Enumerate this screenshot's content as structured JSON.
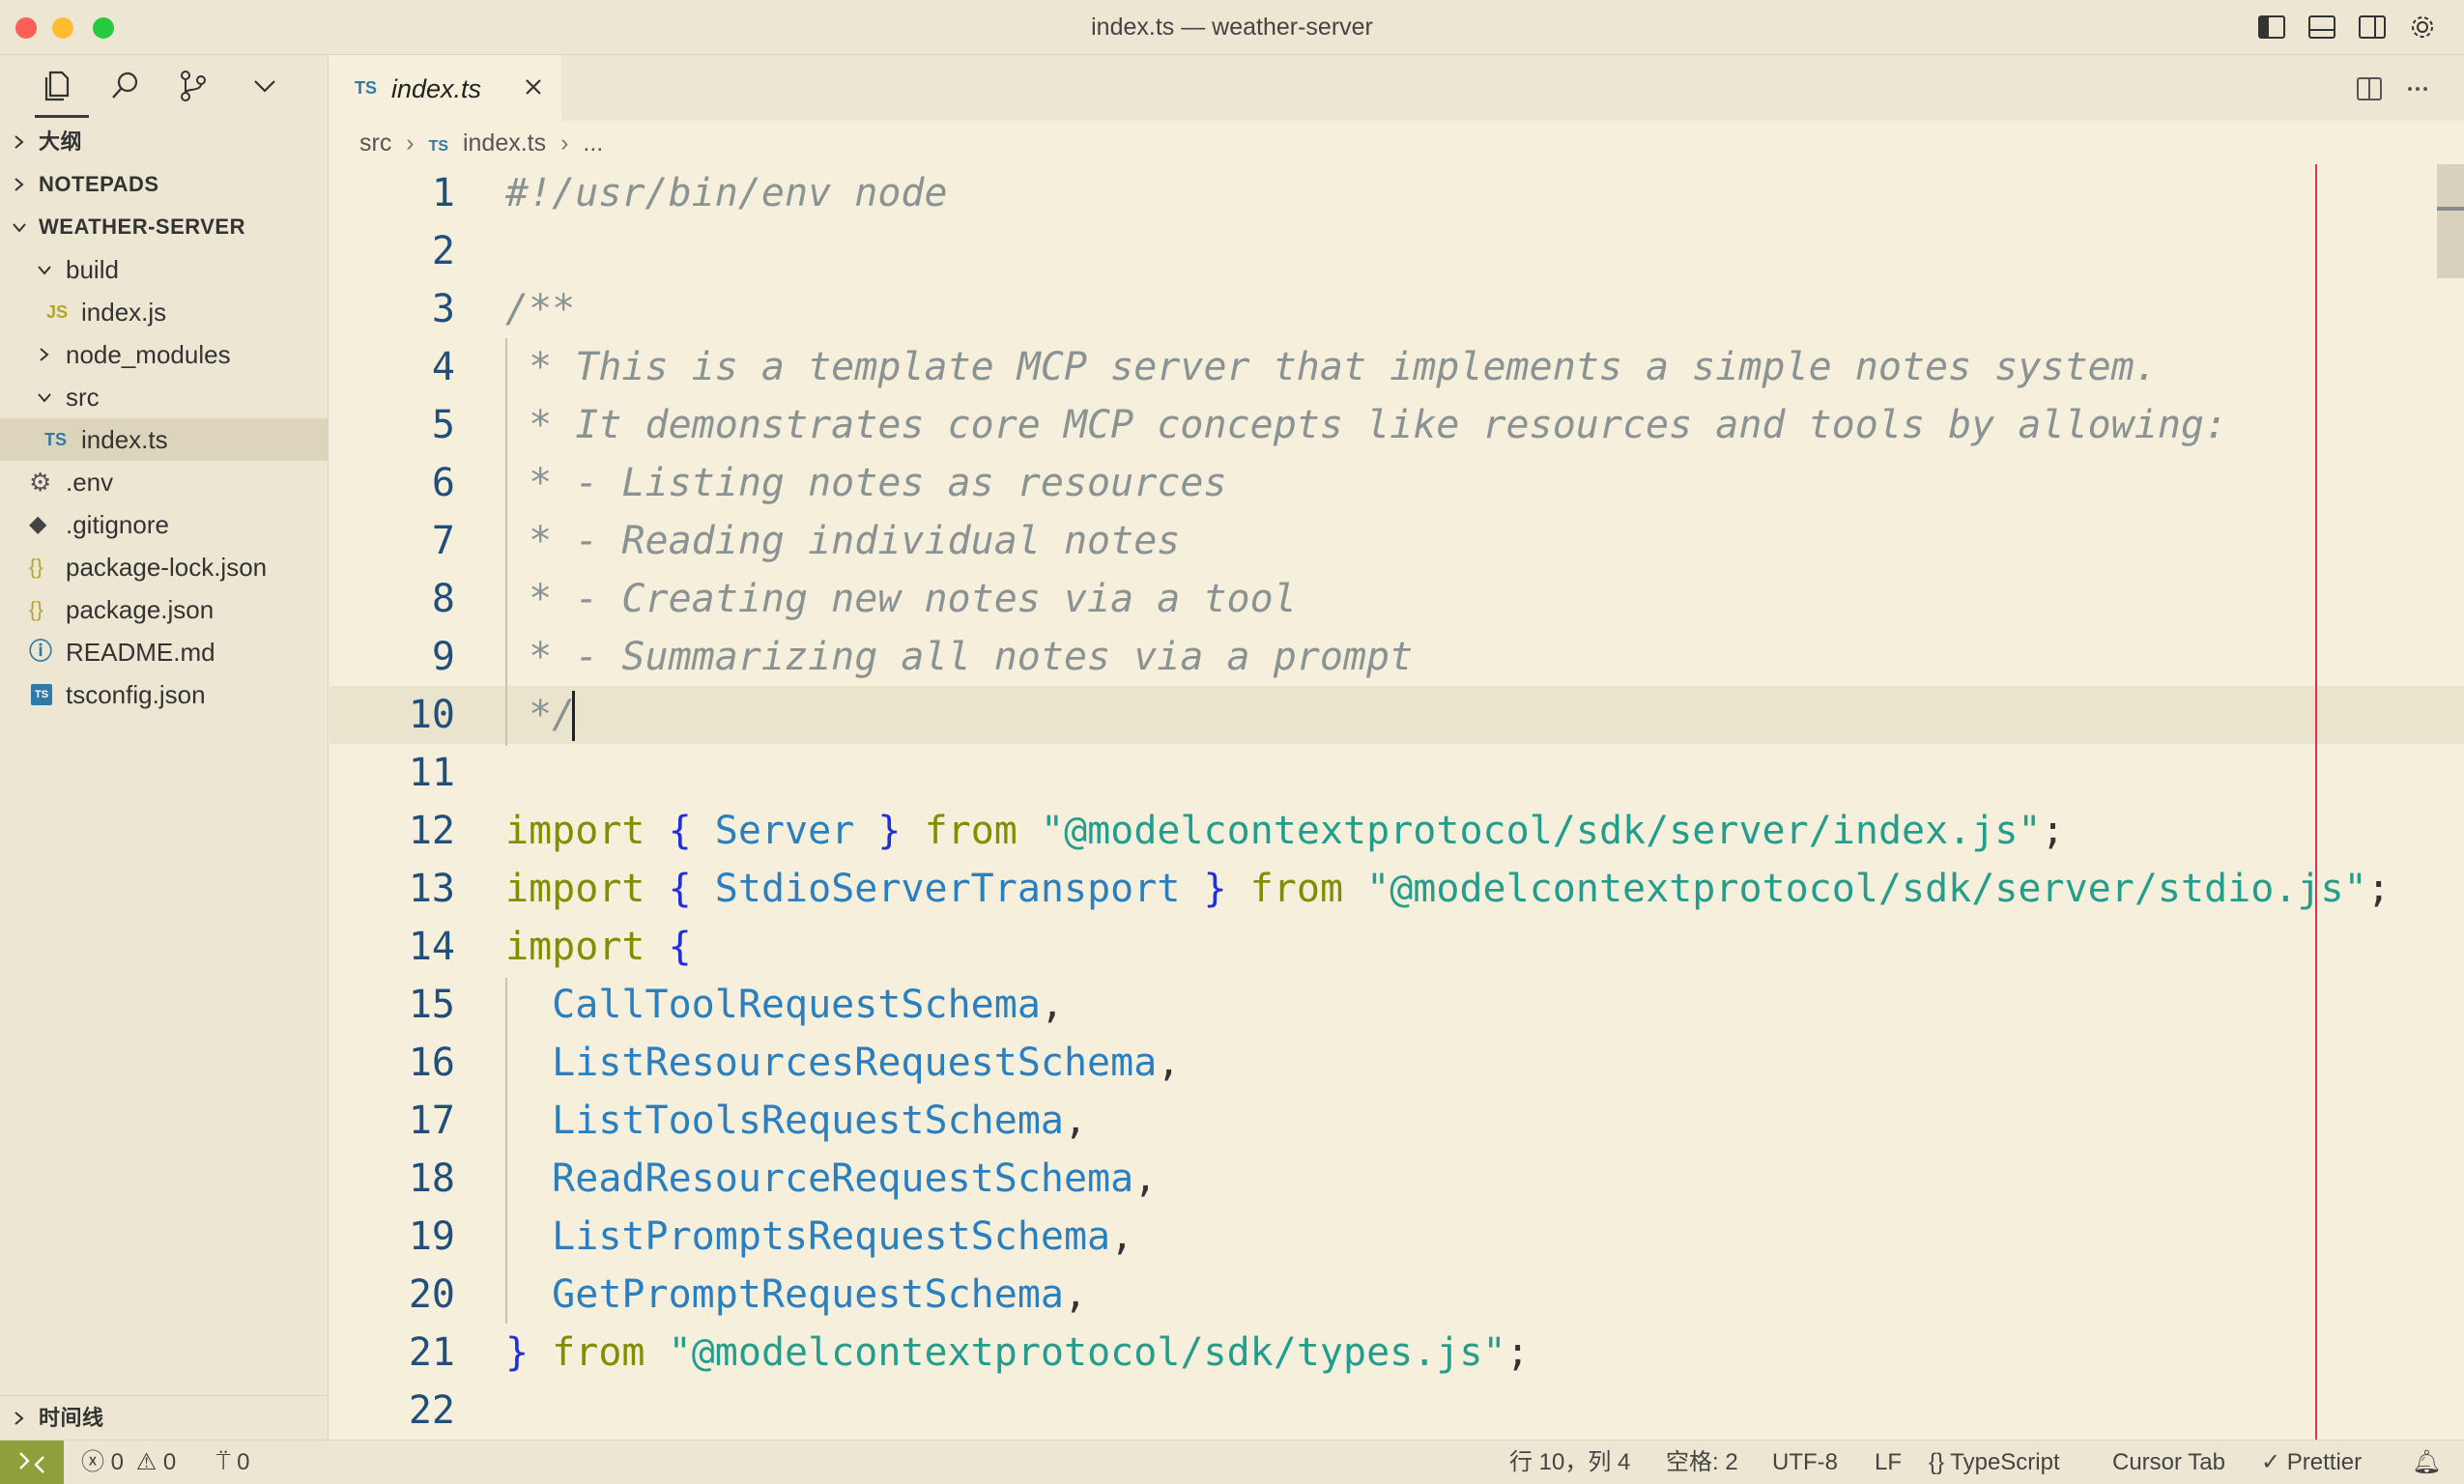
{
  "window": {
    "title": "index.ts — weather-server"
  },
  "sidebar": {
    "sections": {
      "outline": "大纲",
      "notepads": "NOTEPADS",
      "project": "WEATHER-SERVER",
      "timeline": "时间线"
    },
    "tree": {
      "build": "build",
      "build_index": "index.js",
      "node_modules": "node_modules",
      "src": "src",
      "src_index": "index.ts",
      "env": ".env",
      "gitignore": ".gitignore",
      "package_lock": "package-lock.json",
      "package": "package.json",
      "readme": "README.md",
      "tsconfig": "tsconfig.json"
    },
    "icons": {
      "js": "JS",
      "ts": "TS",
      "json": "{}",
      "tsconfig": "TS"
    }
  },
  "editor": {
    "tab": {
      "badge": "TS",
      "label": "index.ts"
    },
    "breadcrumb": {
      "folder": "src",
      "badge": "TS",
      "file": "index.ts",
      "more": "..."
    },
    "lines": [
      {
        "n": "1",
        "t": [
          [
            "comment",
            "#!/usr/bin/env node"
          ]
        ]
      },
      {
        "n": "2",
        "t": []
      },
      {
        "n": "3",
        "t": [
          [
            "comment",
            "/**"
          ]
        ]
      },
      {
        "n": "4",
        "t": [
          [
            "comment",
            " * This is a template MCP server that implements a simple notes system."
          ]
        ]
      },
      {
        "n": "5",
        "t": [
          [
            "comment",
            " * It demonstrates core MCP concepts like resources and tools by allowing:"
          ]
        ]
      },
      {
        "n": "6",
        "t": [
          [
            "comment",
            " * - Listing notes as resources"
          ]
        ]
      },
      {
        "n": "7",
        "t": [
          [
            "comment",
            " * - Reading individual notes"
          ]
        ]
      },
      {
        "n": "8",
        "t": [
          [
            "comment",
            " * - Creating new notes via a tool"
          ]
        ]
      },
      {
        "n": "9",
        "t": [
          [
            "comment",
            " * - Summarizing all notes via a prompt"
          ]
        ]
      },
      {
        "n": "10",
        "t": [
          [
            "comment",
            " */"
          ]
        ]
      },
      {
        "n": "11",
        "t": []
      },
      {
        "n": "12",
        "t": [
          [
            "kw",
            "import"
          ],
          [
            "punc",
            " "
          ],
          [
            "brace",
            "{"
          ],
          [
            "punc",
            " "
          ],
          [
            "id",
            "Server"
          ],
          [
            "punc",
            " "
          ],
          [
            "brace",
            "}"
          ],
          [
            "punc",
            " "
          ],
          [
            "kw",
            "from"
          ],
          [
            "punc",
            " "
          ],
          [
            "str",
            "\"@modelcontextprotocol/sdk/server/index.js\""
          ],
          [
            "punc",
            ";"
          ]
        ]
      },
      {
        "n": "13",
        "t": [
          [
            "kw",
            "import"
          ],
          [
            "punc",
            " "
          ],
          [
            "brace",
            "{"
          ],
          [
            "punc",
            " "
          ],
          [
            "id",
            "StdioServerTransport"
          ],
          [
            "punc",
            " "
          ],
          [
            "brace",
            "}"
          ],
          [
            "punc",
            " "
          ],
          [
            "kw",
            "from"
          ],
          [
            "punc",
            " "
          ],
          [
            "str",
            "\"@modelcontextprotocol/sdk/server/stdio.js\""
          ],
          [
            "punc",
            ";"
          ]
        ]
      },
      {
        "n": "14",
        "t": [
          [
            "kw",
            "import"
          ],
          [
            "punc",
            " "
          ],
          [
            "brace",
            "{"
          ]
        ]
      },
      {
        "n": "15",
        "t": [
          [
            "punc",
            "  "
          ],
          [
            "id",
            "CallToolRequestSchema"
          ],
          [
            "punc",
            ","
          ]
        ]
      },
      {
        "n": "16",
        "t": [
          [
            "punc",
            "  "
          ],
          [
            "id",
            "ListResourcesRequestSchema"
          ],
          [
            "punc",
            ","
          ]
        ]
      },
      {
        "n": "17",
        "t": [
          [
            "punc",
            "  "
          ],
          [
            "id",
            "ListToolsRequestSchema"
          ],
          [
            "punc",
            ","
          ]
        ]
      },
      {
        "n": "18",
        "t": [
          [
            "punc",
            "  "
          ],
          [
            "id",
            "ReadResourceRequestSchema"
          ],
          [
            "punc",
            ","
          ]
        ]
      },
      {
        "n": "19",
        "t": [
          [
            "punc",
            "  "
          ],
          [
            "id",
            "ListPromptsRequestSchema"
          ],
          [
            "punc",
            ","
          ]
        ]
      },
      {
        "n": "20",
        "t": [
          [
            "punc",
            "  "
          ],
          [
            "id",
            "GetPromptRequestSchema"
          ],
          [
            "punc",
            ","
          ]
        ]
      },
      {
        "n": "21",
        "t": [
          [
            "brace",
            "}"
          ],
          [
            "punc",
            " "
          ],
          [
            "kw",
            "from"
          ],
          [
            "punc",
            " "
          ],
          [
            "str",
            "\"@modelcontextprotocol/sdk/types.js\""
          ],
          [
            "punc",
            ";"
          ]
        ]
      },
      {
        "n": "22",
        "t": []
      }
    ],
    "current_line": "10"
  },
  "statusbar": {
    "errors": "0",
    "warnings": "0",
    "ports": "0",
    "position": "行 10，列 4",
    "spaces": "空格: 2",
    "encoding": "UTF-8",
    "eol": "LF",
    "language": "TypeScript",
    "cursor_tab": "Cursor Tab",
    "prettier": "Prettier"
  },
  "colors": {
    "background": "#f5efdc",
    "sidebar": "#ece6d2",
    "keyword": "#7f8f00",
    "identifier": "#2a7fc0",
    "string": "#239e8e",
    "comment": "#8a9394",
    "brace": "#1f2fdb",
    "ruler": "#e0324a",
    "remote": "#8fa03a"
  }
}
